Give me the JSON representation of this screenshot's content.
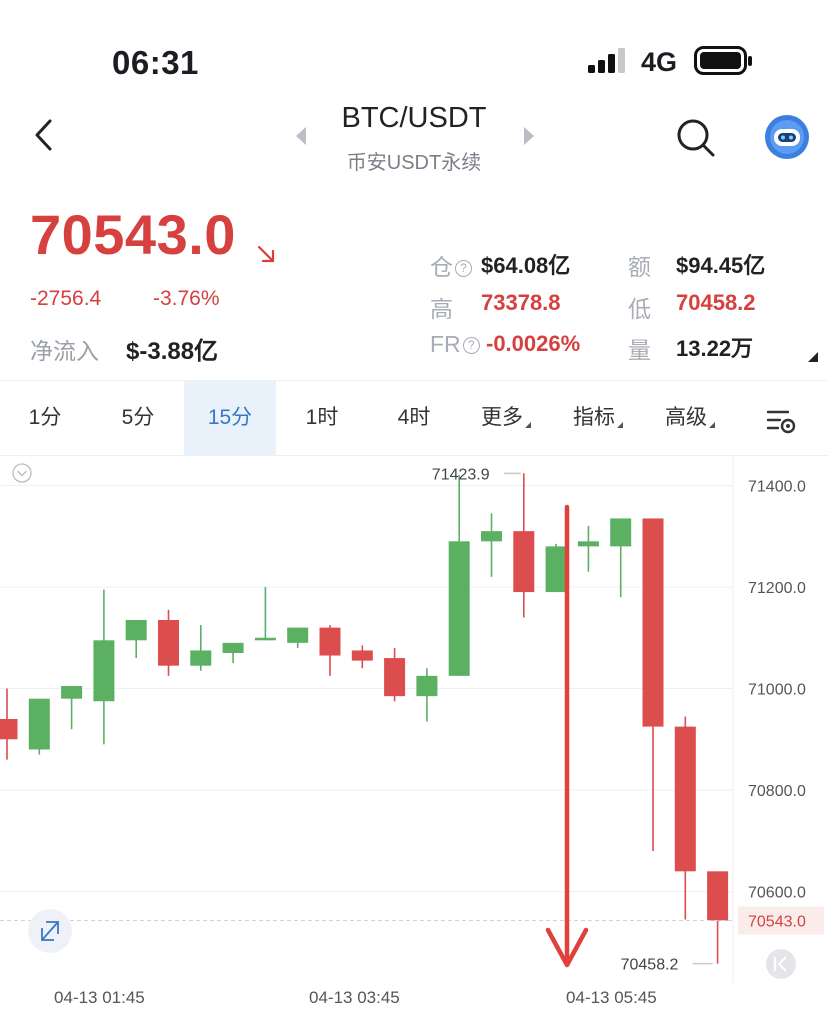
{
  "status": {
    "time": "06:31",
    "network": "4G"
  },
  "header": {
    "title": "BTC/USDT",
    "subtitle": "币安USDT永续"
  },
  "price": {
    "last": "70543.0",
    "change": "-2756.4",
    "change_pct": "-3.76%",
    "inflow_label": "净流入",
    "inflow_value": "$-3.88亿"
  },
  "stats": {
    "oi_label": "仓",
    "oi_value": "$64.08亿",
    "turnover_label": "额",
    "turnover_value": "$94.45亿",
    "high_label": "高",
    "high_value": "73378.8",
    "low_label": "低",
    "low_value": "70458.2",
    "fr_label": "FR",
    "fr_value": "-0.0026%",
    "vol_label": "量",
    "vol_value": "13.22万"
  },
  "tabs": [
    "1分",
    "5分",
    "15分",
    "1时",
    "4时",
    "更多",
    "指标",
    "高级"
  ],
  "active_tab": "15分",
  "colors": {
    "up": "#5bb062",
    "down": "#dc4d4e",
    "accent": "#3977c4",
    "arrow": "#e0413d"
  },
  "chart_data": {
    "type": "candlestick",
    "y_ticks": [
      "71400.0",
      "71200.0",
      "71000.0",
      "70800.0",
      "70600.0"
    ],
    "ylim": [
      70420,
      71460
    ],
    "x_labels": [
      "04-13 01:45",
      "04-13 03:45",
      "04-13 05:45"
    ],
    "high_marker": "71423.9",
    "low_marker": "70458.2",
    "last_price_label": "70543.0",
    "last_price": 70543.0,
    "candles": [
      {
        "o": 70940,
        "h": 71000,
        "l": 70860,
        "c": 70900
      },
      {
        "o": 70880,
        "h": 70960,
        "l": 70870,
        "c": 70980
      },
      {
        "o": 70980,
        "h": 71000,
        "l": 70920,
        "c": 71005
      },
      {
        "o": 70975,
        "h": 71195,
        "l": 70890,
        "c": 71095
      },
      {
        "o": 71095,
        "h": 71130,
        "l": 71060,
        "c": 71135
      },
      {
        "o": 71135,
        "h": 71155,
        "l": 71025,
        "c": 71045
      },
      {
        "o": 71045,
        "h": 71125,
        "l": 71035,
        "c": 71075
      },
      {
        "o": 71070,
        "h": 71080,
        "l": 71050,
        "c": 71090
      },
      {
        "o": 71095,
        "h": 71200,
        "l": 71095,
        "c": 71100
      },
      {
        "o": 71090,
        "h": 71120,
        "l": 71080,
        "c": 71120
      },
      {
        "o": 71120,
        "h": 71125,
        "l": 71025,
        "c": 71065
      },
      {
        "o": 71075,
        "h": 71085,
        "l": 71040,
        "c": 71055
      },
      {
        "o": 71060,
        "h": 71080,
        "l": 70975,
        "c": 70985
      },
      {
        "o": 70985,
        "h": 71040,
        "l": 70935,
        "c": 71025
      },
      {
        "o": 71025,
        "h": 71420,
        "l": 71025,
        "c": 71290
      },
      {
        "o": 71290,
        "h": 71345,
        "l": 71220,
        "c": 71310
      },
      {
        "o": 71310,
        "h": 71424,
        "l": 71140,
        "c": 71190
      },
      {
        "o": 71190,
        "h": 71285,
        "l": 71190,
        "c": 71280
      },
      {
        "o": 71280,
        "h": 71320,
        "l": 71230,
        "c": 71290
      },
      {
        "o": 71280,
        "h": 71335,
        "l": 71180,
        "c": 71335
      },
      {
        "o": 71335,
        "h": 71335,
        "l": 70680,
        "c": 70925
      },
      {
        "o": 70925,
        "h": 70945,
        "l": 70545,
        "c": 70640
      },
      {
        "o": 70640,
        "h": 70640,
        "l": 70458,
        "c": 70543
      }
    ]
  }
}
